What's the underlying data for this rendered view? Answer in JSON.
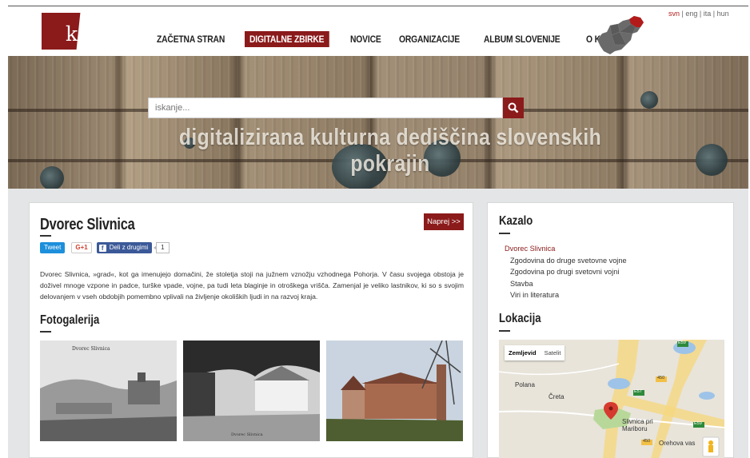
{
  "header": {
    "logo_text": "kamra",
    "nav": [
      "ZAČETNA STRAN",
      "DIGITALNE ZBIRKE",
      "NOVICE",
      "ORGANIZACIJE",
      "ALBUM SLOVENIJE",
      "O KAMRI"
    ],
    "active_nav_index": 1,
    "languages": [
      "svn",
      "eng",
      "ita",
      "hun"
    ],
    "active_language": "svn"
  },
  "hero": {
    "search_placeholder": "iskanje...",
    "tagline": "digitalizirana kulturna dediščina slovenskih pokrajin"
  },
  "article": {
    "title": "Dvorec Slivnica",
    "next_label": "Naprej >>",
    "tweet_label": "Tweet",
    "gplus_label": "G+1",
    "share_label": "Deli z drugimi",
    "share_count": "1",
    "description": "Dvorec Slivnica, »grad«, kot ga imenujejo domačini, že stoletja stoji na južnem vznožju vzhodnega Pohorja. V času svojega obstoja je doživel mnoge vzpone in padce, turške vpade, vojne, pa tudi leta blaginje in otroškega vrišča. Zamenjal je veliko lastnikov, ki so s svojim delovanjem v vseh obdobjih pomembno vplivali na življenje okoliških ljudi in na razvoj kraja.",
    "gallery_title": "Fotogalerija"
  },
  "sidebar": {
    "toc_title": "Kazalo",
    "toc": [
      {
        "label": "Dvorec Slivnica",
        "current": true
      },
      {
        "label": "Zgodovina do druge svetovne vojne",
        "current": false
      },
      {
        "label": "Zgodovina po drugi svetovni vojni",
        "current": false
      },
      {
        "label": "Stavba",
        "current": false
      },
      {
        "label": "Viri in literatura",
        "current": false
      }
    ],
    "location_title": "Lokacija",
    "map": {
      "tab_map": "Zemljevid",
      "tab_satellite": "Satelit",
      "labels": [
        "Polana",
        "Čreta",
        "Slivnica pri",
        "Mariboru",
        "Orehova vas"
      ],
      "road_labels": [
        "E57",
        "E57",
        "450",
        "450",
        "E59",
        "E59"
      ]
    }
  },
  "colors": {
    "brand": "#8b1a1a",
    "tweet": "#1d8fdb",
    "facebook": "#3b5998"
  }
}
